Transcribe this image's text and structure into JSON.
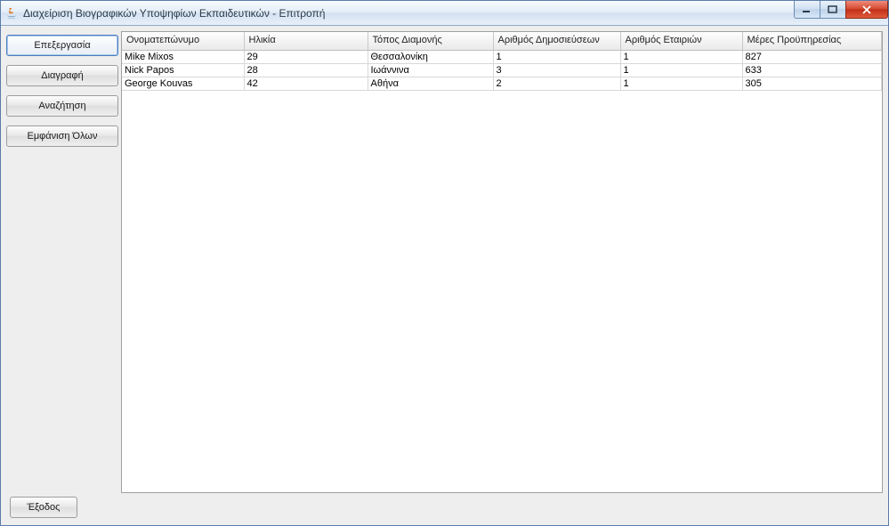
{
  "window": {
    "title": "Διαχείριση Βιογραφικών Υποψηφίων Εκπαιδευτικών - Επιτροπή"
  },
  "sidebar": {
    "edit": "Επεξεργασία",
    "delete": "Διαγραφή",
    "search": "Αναζήτηση",
    "show_all": "Εμφάνιση Όλων"
  },
  "table": {
    "headers": {
      "name": "Ονοματεπώνυμο",
      "age": "Ηλικία",
      "residence": "Τόπος Διαμονής",
      "publications": "Αριθμός Δημοσιεύσεων",
      "companies": "Αριθμός Εταιριών",
      "service_days": "Μέρες Προϋπηρεσίας"
    },
    "rows": [
      {
        "name": "Mike Mixos",
        "age": "29",
        "residence": "Θεσσαλονίκη",
        "publications": "1",
        "companies": "1",
        "service_days": "827"
      },
      {
        "name": "Nick Papos",
        "age": "28",
        "residence": "Ιωάννινα",
        "publications": "3",
        "companies": "1",
        "service_days": "633"
      },
      {
        "name": "George Kouvas",
        "age": "42",
        "residence": "Αθήνα",
        "publications": "2",
        "companies": "1",
        "service_days": "305"
      }
    ]
  },
  "footer": {
    "exit": "Έξοδος"
  }
}
